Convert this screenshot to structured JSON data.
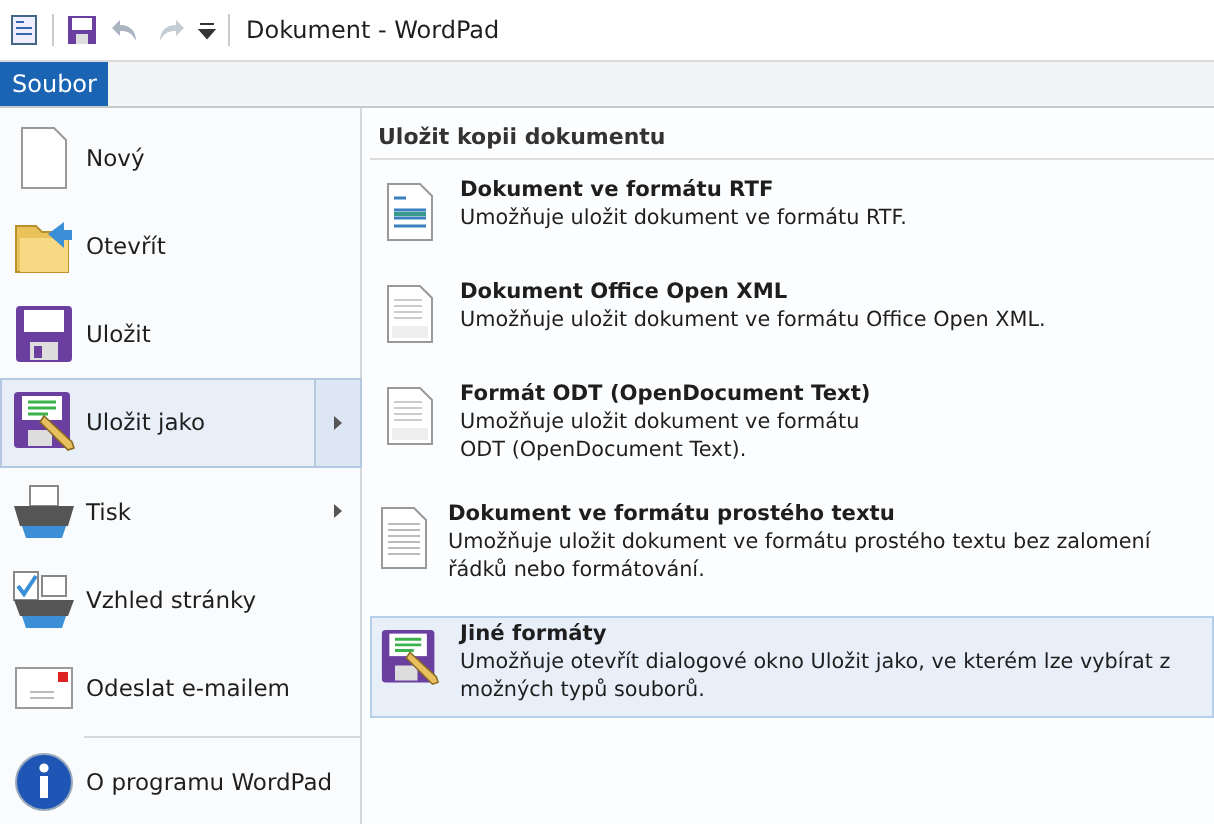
{
  "window": {
    "title": "Dokument - WordPad"
  },
  "ribbon_tabs": [
    {
      "label": "Soubor",
      "selected": true
    }
  ],
  "menu": [
    {
      "label": "Nový",
      "kind": "page",
      "selected": false,
      "submenu": false
    },
    {
      "label": "Otevřít",
      "kind": "folder",
      "selected": false,
      "submenu": false
    },
    {
      "label": "Uložit",
      "kind": "disk",
      "selected": false,
      "submenu": false
    },
    {
      "label": "Uložit jako",
      "kind": "saveas",
      "selected": true,
      "submenu": true
    },
    {
      "label": "Tisk",
      "kind": "printer",
      "selected": false,
      "submenu": true
    },
    {
      "label": "Vzhled stránky",
      "kind": "pagesetup",
      "selected": false,
      "submenu": false
    },
    {
      "label": "Odeslat e-mailem",
      "kind": "email",
      "selected": false,
      "submenu": false
    },
    {
      "label": "O programu WordPad",
      "kind": "about",
      "selected": false,
      "submenu": false
    }
  ],
  "panel": {
    "title": "Uložit kopii dokumentu",
    "items": [
      {
        "title": "Dokument ve formátu RTF",
        "description": "Umožňuje uložit dokument ve formátu RTF.",
        "kind": "rtf",
        "selected": false
      },
      {
        "title": "Dokument Office Open XML",
        "description": "Umožňuje uložit dokument ve formátu Office Open XML.",
        "kind": "docx",
        "selected": false
      },
      {
        "title": "Formát ODT (OpenDocument Text)",
        "description": "Umožňuje uložit dokument ve formátu\nODT (OpenDocument Text).",
        "kind": "odt",
        "selected": false
      },
      {
        "title": "Dokument ve formátu prostého textu",
        "description": "Umožňuje uložit dokument ve formátu prostého textu bez zalomení řádků nebo formátování.",
        "kind": "txt",
        "selected": false
      },
      {
        "title": "Jiné formáty",
        "description": "Umožňuje otevřít dialogové okno Uložit jako, ve kterém lze vybírat z možných typů souborů.",
        "kind": "saveas",
        "selected": true
      }
    ]
  }
}
